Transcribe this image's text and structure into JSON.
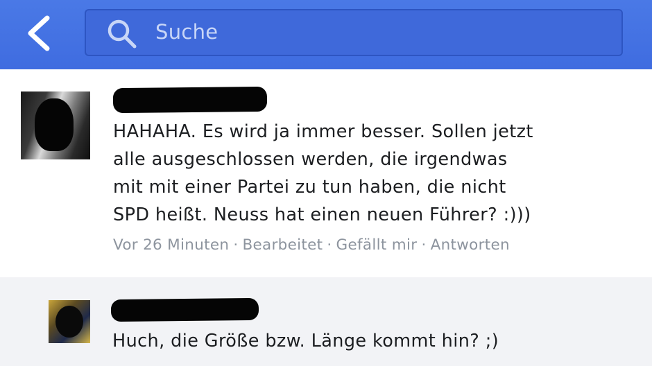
{
  "nav": {
    "back_icon": "chevron-left-icon",
    "search_icon": "search-icon",
    "search_placeholder": "Suche"
  },
  "comments": [
    {
      "author": "",
      "lines": [
        "HAHAHA. Es wird ja immer besser. Sollen jetzt",
        "alle ausgeschlossen werden, die irgendwas",
        "mit mit einer Partei zu tun haben, die nicht",
        "SPD heißt. Neuss hat einen neuen Führer? :)))"
      ],
      "time": "Vor 26 Minuten",
      "edited": "Bearbeitet",
      "like": "Gefällt mir",
      "reply": "Antworten",
      "separator": "·"
    },
    {
      "author": "",
      "lines": [
        "Huch, die Größe bzw. Länge kommt hin? ;)"
      ]
    }
  ],
  "colors": {
    "topbar": "#4a79e6",
    "searchbox": "#3f69da",
    "text": "#1c1e21",
    "meta": "#8d949e",
    "reply_bg": "#f2f3f6"
  }
}
